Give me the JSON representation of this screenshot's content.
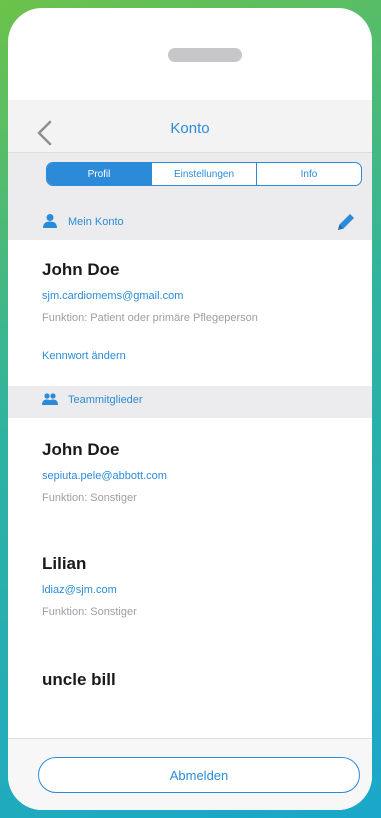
{
  "nav": {
    "title": "Konto",
    "back_icon": "chevron-left-icon"
  },
  "tabs": [
    {
      "label": "Profil",
      "active": true
    },
    {
      "label": "Einstellungen",
      "active": false
    },
    {
      "label": "Info",
      "active": false
    }
  ],
  "my_account": {
    "header": "Mein Konto",
    "header_icon": "user-icon",
    "edit_icon": "pencil-icon",
    "name": "John Doe",
    "email": "sjm.cardiomems@gmail.com",
    "role": "Funktion: Patient oder primäre Pflegeperson",
    "change_password": "Kennwort ändern"
  },
  "team": {
    "header": "Teammitglieder",
    "header_icon": "team-icon",
    "members": [
      {
        "name": "John Doe",
        "email": "sepiuta.pele@abbott.com",
        "role": "Funktion: Sonstiger"
      },
      {
        "name": "Lilian",
        "email": "ldiaz@sjm.com",
        "role": "Funktion: Sonstiger"
      },
      {
        "name": "uncle bill",
        "email": "",
        "role": ""
      }
    ]
  },
  "footer": {
    "logout_label": "Abmelden"
  },
  "colors": {
    "accent": "#2b8bd9",
    "background": "#ececee",
    "card": "#ffffff"
  }
}
